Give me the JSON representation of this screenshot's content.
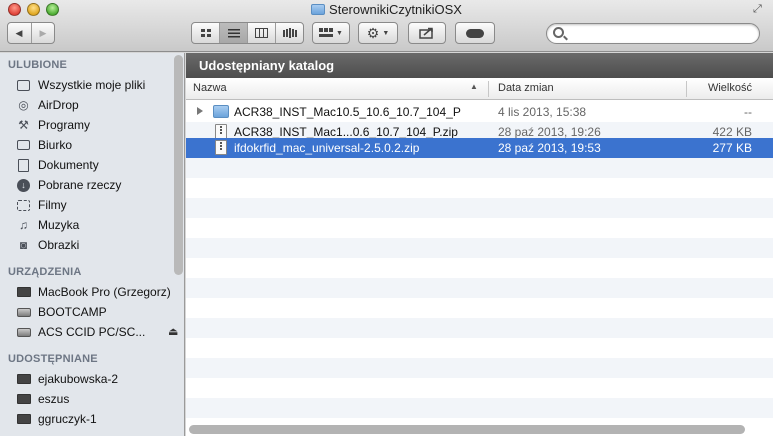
{
  "window": {
    "title": "SterownikiCzytnikiOSX"
  },
  "toolbar": {
    "back_glyph": "◀",
    "forward_glyph": "▶",
    "view_modes": [
      "icons-view-icon",
      "list-view-icon",
      "columns-view-icon",
      "coverflow-view-icon"
    ],
    "arrange_icon": "arrange-icon",
    "action_icon": "gear-icon",
    "share_icon": "share-icon",
    "tags_icon": "toggle-icon",
    "search_placeholder": ""
  },
  "sidebar": {
    "sections": [
      {
        "title": "ULUBIONE",
        "items": [
          {
            "label": "Wszystkie moje pliki",
            "icon": "all-files-icon"
          },
          {
            "label": "AirDrop",
            "icon": "airdrop-icon"
          },
          {
            "label": "Programy",
            "icon": "applications-icon"
          },
          {
            "label": "Biurko",
            "icon": "desktop-icon"
          },
          {
            "label": "Dokumenty",
            "icon": "documents-icon"
          },
          {
            "label": "Pobrane rzeczy",
            "icon": "downloads-icon"
          },
          {
            "label": "Filmy",
            "icon": "movies-icon"
          },
          {
            "label": "Muzyka",
            "icon": "music-icon"
          },
          {
            "label": "Obrazki",
            "icon": "pictures-icon"
          }
        ]
      },
      {
        "title": "URZĄDZENIA",
        "items": [
          {
            "label": "MacBook Pro (Grzegorz)",
            "icon": "laptop-icon"
          },
          {
            "label": "BOOTCAMP",
            "icon": "drive-icon"
          },
          {
            "label": "ACS CCID PC/SC...",
            "icon": "drive-icon",
            "eject": "⏏"
          }
        ]
      },
      {
        "title": "UDOSTĘPNIANE",
        "items": [
          {
            "label": "ejakubowska-2",
            "icon": "network-computer-icon"
          },
          {
            "label": "eszus",
            "icon": "network-computer-icon"
          },
          {
            "label": "ggruczyk-1",
            "icon": "network-computer-icon"
          }
        ]
      }
    ]
  },
  "main": {
    "path_title": "Udostępniany katalog",
    "columns": {
      "name": "Nazwa",
      "date": "Data zmian",
      "size": "Wielkość"
    },
    "files": [
      {
        "name": "ACR38_INST_Mac10.5_10.6_10.7_104_P",
        "date": "4 lis 2013, 15:38",
        "size": "--",
        "kind": "folder"
      },
      {
        "name": "ACR38_INST_Mac1...0.6_10.7_104_P.zip",
        "date": "28 paź 2013, 19:26",
        "size": "422 KB",
        "kind": "zip"
      },
      {
        "name": "ifdokrfid_mac_universal-2.5.0.2.zip",
        "date": "28 paź 2013, 19:53",
        "size": "277 KB",
        "kind": "zip",
        "selected": true
      }
    ]
  },
  "colors": {
    "selection": "#3b73cf",
    "path_bar": "#5a5a5a",
    "sidebar_bg": "#e2e6eb"
  }
}
